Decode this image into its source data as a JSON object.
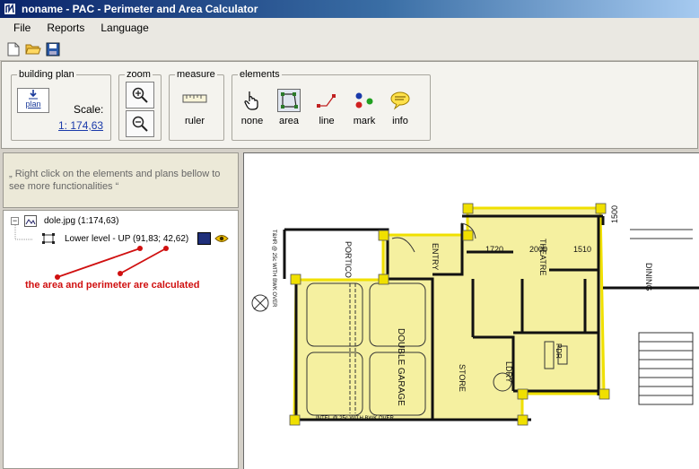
{
  "window": {
    "title": "noname - PAC - Perimeter and Area Calculator"
  },
  "menu": [
    "File",
    "Reports",
    "Language"
  ],
  "toolbar": {
    "buttons": [
      "new-file-icon",
      "open-folder-icon",
      "save-disk-icon"
    ]
  },
  "ribbon": {
    "building_plan": {
      "legend": "building plan",
      "button_label": "plan",
      "scale_label": "Scale:",
      "scale_value": "1: 174,63"
    },
    "zoom": {
      "legend": "zoom"
    },
    "measure": {
      "legend": "measure",
      "ruler_label": "ruler"
    },
    "elements": {
      "legend": "elements",
      "items": [
        {
          "label": "none",
          "icon": "hand-pointer-icon"
        },
        {
          "label": "area",
          "icon": "area-polygon-icon",
          "active": true
        },
        {
          "label": "line",
          "icon": "line-icon"
        },
        {
          "label": "mark",
          "icon": "mark-dots-icon"
        },
        {
          "label": "info",
          "icon": "info-bubble-icon"
        }
      ]
    }
  },
  "left_panel": {
    "hint": "„ Right click on the elements and plans bellow to see more functionalities “",
    "tree": {
      "root": {
        "expander": "−",
        "label": "dole.jpg (1:174,63)"
      },
      "child": {
        "label": "Lower level - UP (91,83; 42,62)"
      }
    },
    "annotation": "the area and perimeter are calculated"
  },
  "plan": {
    "rooms": [
      "THEATRE",
      "ENTRY",
      "PORTICO",
      "DOUBLE GARAGE",
      "STORE",
      "LDRY",
      "PDR",
      "DINING"
    ],
    "dimensions": [
      "1720",
      "2000",
      "1510",
      "1500"
    ],
    "notes": [
      "INTEL @ 25c WITH BWK OVER",
      "T&HR @ 25c WITH BWK OVER"
    ]
  },
  "colors": {
    "area_fill": "#f5f0a0",
    "area_stroke": "#f0e000",
    "annotation": "#d01010",
    "title_bar": "#0a246a"
  }
}
